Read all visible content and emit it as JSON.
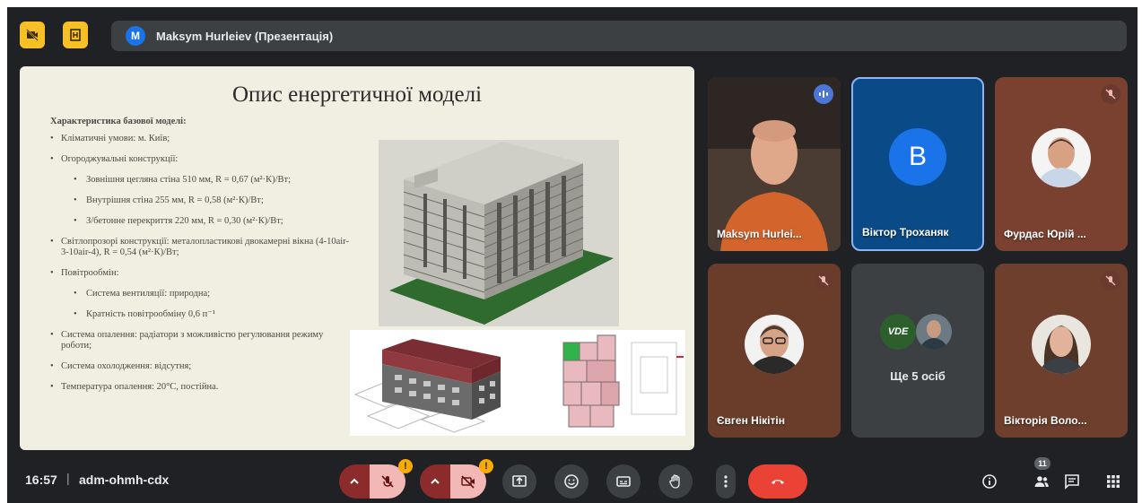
{
  "header": {
    "presenter_initial": "M",
    "presenter_label": "Maksym Hurleiev (Презентація)"
  },
  "slide": {
    "title": "Опис енергетичної моделі",
    "heading": "Характеристика базової моделі:",
    "items": [
      {
        "level": 1,
        "text": "Кліматичні умови: м. Київ;"
      },
      {
        "level": 1,
        "text": "Огороджувальні конструкції:"
      },
      {
        "level": 2,
        "text": "Зовнішня цегляна стіна 510 мм, R = 0,67 (м²·К)/Вт;"
      },
      {
        "level": 2,
        "text": "Внутрішня стіна 255 мм, R = 0,58 (м²·К)/Вт;"
      },
      {
        "level": 2,
        "text": "З/бетонне перекриття 220 мм, R = 0,30 (м²·К)/Вт;"
      },
      {
        "level": 1,
        "text": "Світлопрозорі конструкції: металопластикові двокамерні вікна (4-10air-3-10air-4), R = 0,54 (м²·К)/Вт;"
      },
      {
        "level": 1,
        "text": "Повітрообмін:"
      },
      {
        "level": 2,
        "text": "Система вентиляції: природна;"
      },
      {
        "level": 2,
        "text": "Кратність повітрообміну 0,6 п⁻¹"
      },
      {
        "level": 1,
        "text": "Система опалення: радіатори з можливістю регулювання режиму роботи;"
      },
      {
        "level": 1,
        "text": "Система охолодження: відсутня;"
      },
      {
        "level": 1,
        "text": "Температура опалення: 20°С, постійна."
      }
    ]
  },
  "participants": [
    {
      "name": "Maksym Hurlei...",
      "speaking": true
    },
    {
      "name": "Віктор Троханяк",
      "initial": "B"
    },
    {
      "name": "Фурдас Юрій ...",
      "muted": true
    },
    {
      "name": "Євген Нікітін",
      "muted": true
    },
    {
      "name": "Ще 5 осіб"
    },
    {
      "name": "Вікторія Воло...",
      "muted": true
    }
  ],
  "others_tile": {
    "badge_text": "VDE"
  },
  "bottom_bar": {
    "time": "16:57",
    "separator": "|",
    "meeting_code": "adm-ohmh-cdx",
    "mic_warning": "!",
    "camera_warning": "!",
    "people_count": "11"
  },
  "colors": {
    "background": "#202124",
    "accent_yellow": "#f6c026",
    "end_call_red": "#ea4335",
    "active_tile_border": "#8ab4f8",
    "slide_background": "#f1efe1"
  },
  "icons": [
    "camera-off-icon",
    "frame-icon",
    "chevron-up-icon",
    "mic-off-icon",
    "present-icon",
    "emoji-icon",
    "captions-icon",
    "raise-hand-icon",
    "more-vert-icon",
    "end-call-icon",
    "info-icon",
    "people-icon",
    "chat-icon",
    "apps-icon"
  ]
}
